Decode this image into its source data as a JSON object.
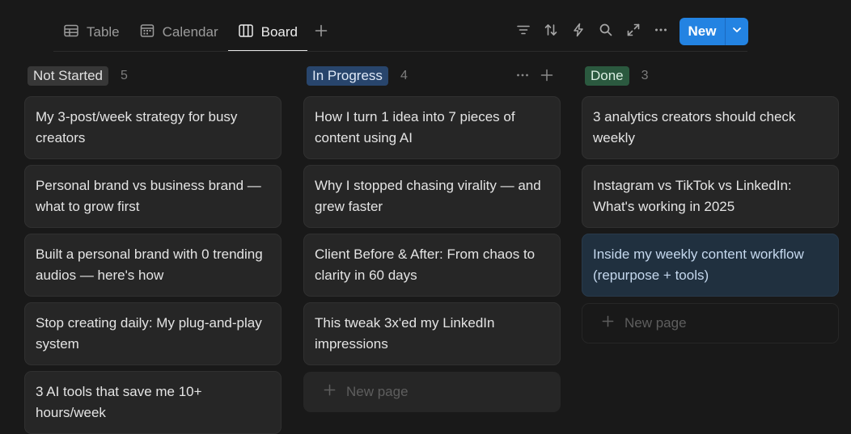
{
  "views": [
    {
      "label": "Table",
      "icon": "table-icon",
      "active": false
    },
    {
      "label": "Calendar",
      "icon": "calendar-icon",
      "active": false
    },
    {
      "label": "Board",
      "icon": "board-icon",
      "active": true
    }
  ],
  "toolbar": {
    "icons": [
      "filter-icon",
      "sort-icon",
      "automation-bolt-icon",
      "search-icon",
      "expand-icon",
      "more-icon"
    ],
    "new_label": "New"
  },
  "colors": {
    "accent": "#2383e2",
    "not_started": "#373737",
    "in_progress": "#28456c",
    "done": "#2b593f"
  },
  "columns": [
    {
      "status": "Not Started",
      "count": "5",
      "cards": [
        "My 3-post/week strategy for busy creators",
        "Personal brand vs business brand — what to grow first",
        "Built a personal brand with 0 trending audios — here's how",
        "Stop creating daily: My plug-and-play system",
        "3 AI tools that save me 10+ hours/week"
      ]
    },
    {
      "status": "In Progress",
      "count": "4",
      "cards": [
        "How I turn 1 idea into 7 pieces of content using AI",
        "Why I stopped chasing virality — and grew faster",
        "Client Before & After: From chaos to clarity in 60 days",
        "This tweak 3x'ed my LinkedIn impressions"
      ],
      "new_page_label": "New page"
    },
    {
      "status": "Done",
      "count": "3",
      "cards": [
        "3 analytics creators should check weekly",
        "Instagram vs TikTok vs LinkedIn: What's working in 2025",
        "Inside my weekly content workflow (repurpose + tools)"
      ],
      "new_page_label": "New page"
    }
  ]
}
